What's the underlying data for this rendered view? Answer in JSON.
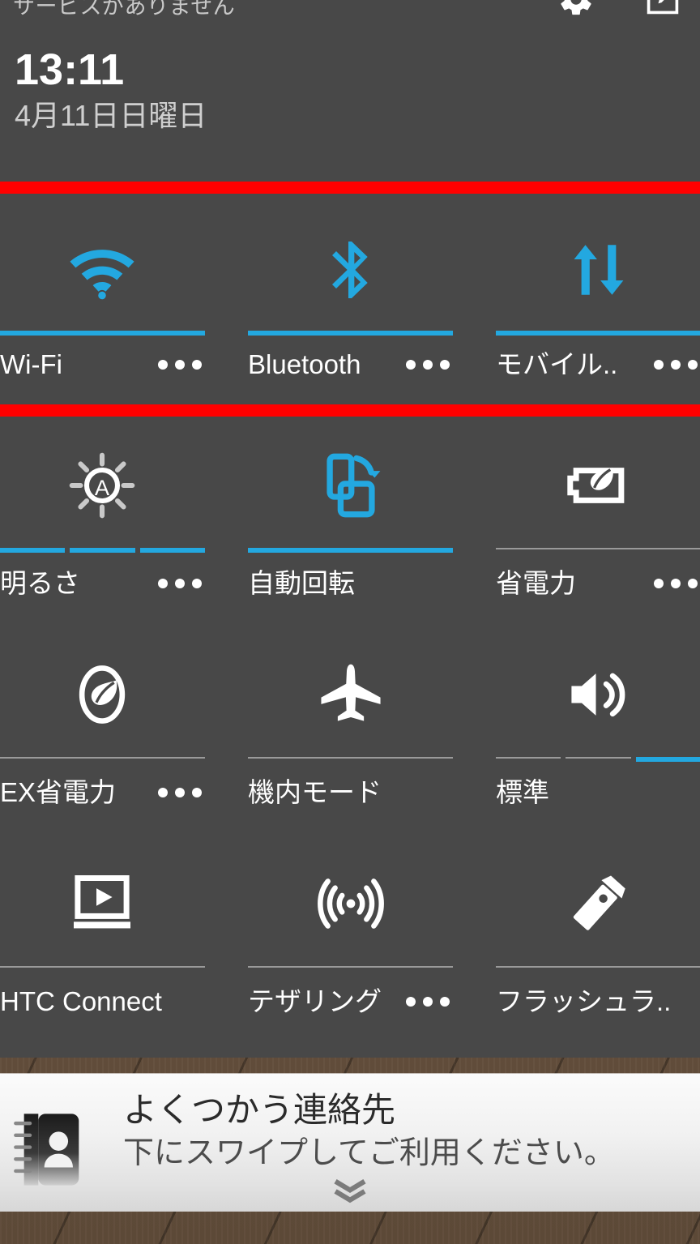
{
  "statusbar": {
    "carrier": "サービスがありません",
    "icons": [
      {
        "name": "settings-gear-icon",
        "label": "設定"
      },
      {
        "name": "edit-notifications-icon",
        "label": "編集"
      }
    ]
  },
  "header": {
    "time": "13:11",
    "date": "4月11日日曜日"
  },
  "colors": {
    "panel_bg": "#484848",
    "accent_on": "#23a8e0",
    "divider_red": "#ff0000",
    "inactive": "#8c8c8c",
    "text": "#ffffff",
    "wallpaper": "#6d5742"
  },
  "quick_settings": {
    "rows": [
      {
        "row_index": 0,
        "tiles": [
          {
            "label": "Wi-Fi",
            "icon": "wifi-icon",
            "state": "on",
            "segments": [
              1
            ],
            "has_more": true
          },
          {
            "label": "Bluetooth",
            "icon": "bluetooth-icon",
            "state": "on",
            "segments": [
              1
            ],
            "has_more": true
          },
          {
            "label": "モバイル..",
            "icon": "mobile-data-icon",
            "state": "on",
            "segments": [
              1
            ],
            "has_more": true
          }
        ]
      },
      {
        "row_index": 1,
        "tiles": [
          {
            "label": "明るさ",
            "icon": "brightness-auto-icon",
            "state": "on",
            "segments": [
              1,
              1,
              1
            ],
            "has_more": true
          },
          {
            "label": "自動回転",
            "icon": "auto-rotate-icon",
            "state": "on",
            "segments": [
              1
            ],
            "has_more": false
          },
          {
            "label": "省電力",
            "icon": "battery-saver-icon",
            "state": "off",
            "segments": [
              0
            ],
            "has_more": true
          }
        ]
      },
      {
        "row_index": 2,
        "tiles": [
          {
            "label": "EX省電力",
            "icon": "extreme-power-saver-icon",
            "state": "off",
            "segments": [
              0
            ],
            "has_more": true
          },
          {
            "label": "機内モード",
            "icon": "airplane-mode-icon",
            "state": "off",
            "segments": [
              0
            ],
            "has_more": false
          },
          {
            "label": "標準",
            "icon": "sound-profile-icon",
            "state": "partial",
            "segments": [
              0,
              0,
              1
            ],
            "has_more": false
          }
        ]
      },
      {
        "row_index": 3,
        "tiles": [
          {
            "label": "HTC Connect",
            "icon": "htc-connect-icon",
            "state": "off",
            "segments": [
              0
            ],
            "has_more": false
          },
          {
            "label": "テザリング",
            "icon": "tethering-icon",
            "state": "off",
            "segments": [
              0
            ],
            "has_more": true
          },
          {
            "label": "フラッシュラ..",
            "icon": "flashlight-icon",
            "state": "off",
            "segments": [
              0
            ],
            "has_more": false
          }
        ]
      }
    ]
  },
  "peek_notification": {
    "icon": "contacts-book-icon",
    "title": "よくつかう連絡先",
    "subtitle": "下にスワイプしてご利用ください。",
    "chevron": "double-chevron-down-icon"
  }
}
